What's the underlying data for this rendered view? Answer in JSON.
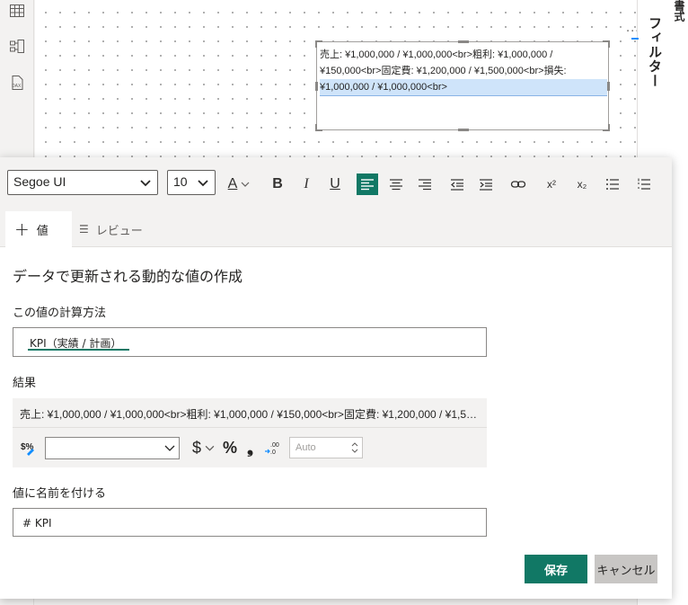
{
  "canvas": {
    "more_label": "···",
    "textbox_lines": [
      "売上: ¥1,000,000 / ¥1,000,000<br>粗利: ¥1,000,000 /",
      "¥150,000<br>固定費: ¥1,200,000 / ¥1,500,000<br>損失:",
      "¥1,000,000 / ¥1,000,000<br>"
    ]
  },
  "right_pane": {
    "filter_label": "フィルター",
    "mode_label": "書式"
  },
  "toolbar": {
    "font_family": "Segoe UI",
    "font_size": "10",
    "font_color_glyph": "A",
    "bold_glyph": "B",
    "italic_glyph": "I",
    "underline_glyph": "U",
    "superscript_glyph": "x²",
    "subscript_glyph": "x₂"
  },
  "tabs": [
    {
      "glyph": "+",
      "label": "値"
    },
    {
      "glyph": "☰",
      "label": "レビュー"
    }
  ],
  "dialog": {
    "heading": "データで更新される動的な値の作成",
    "calc_label": "この値の計算方法",
    "calc_value": "KPI（実績 / 計画）",
    "result_label": "結果",
    "result_text": "売上: ¥1,000,000 / ¥1,000,000<br>粗利: ¥1,000,000 / ¥150,000<br>固定費: ¥1,200,000 / ¥1,500,000<br>損失: ¥1,000,000 / ¥1,000,000<br>",
    "format": {
      "currency_glyph": "$",
      "percent_glyph": "%",
      "comma_glyph": "❟",
      "decimals_placeholder": "Auto"
    },
    "name_label": "値に名前を付ける",
    "name_value": "# KPI",
    "save_label": "保存",
    "cancel_label": "キャンセル"
  },
  "colors": {
    "accent": "#117865",
    "selection": "#cfe4fa"
  }
}
